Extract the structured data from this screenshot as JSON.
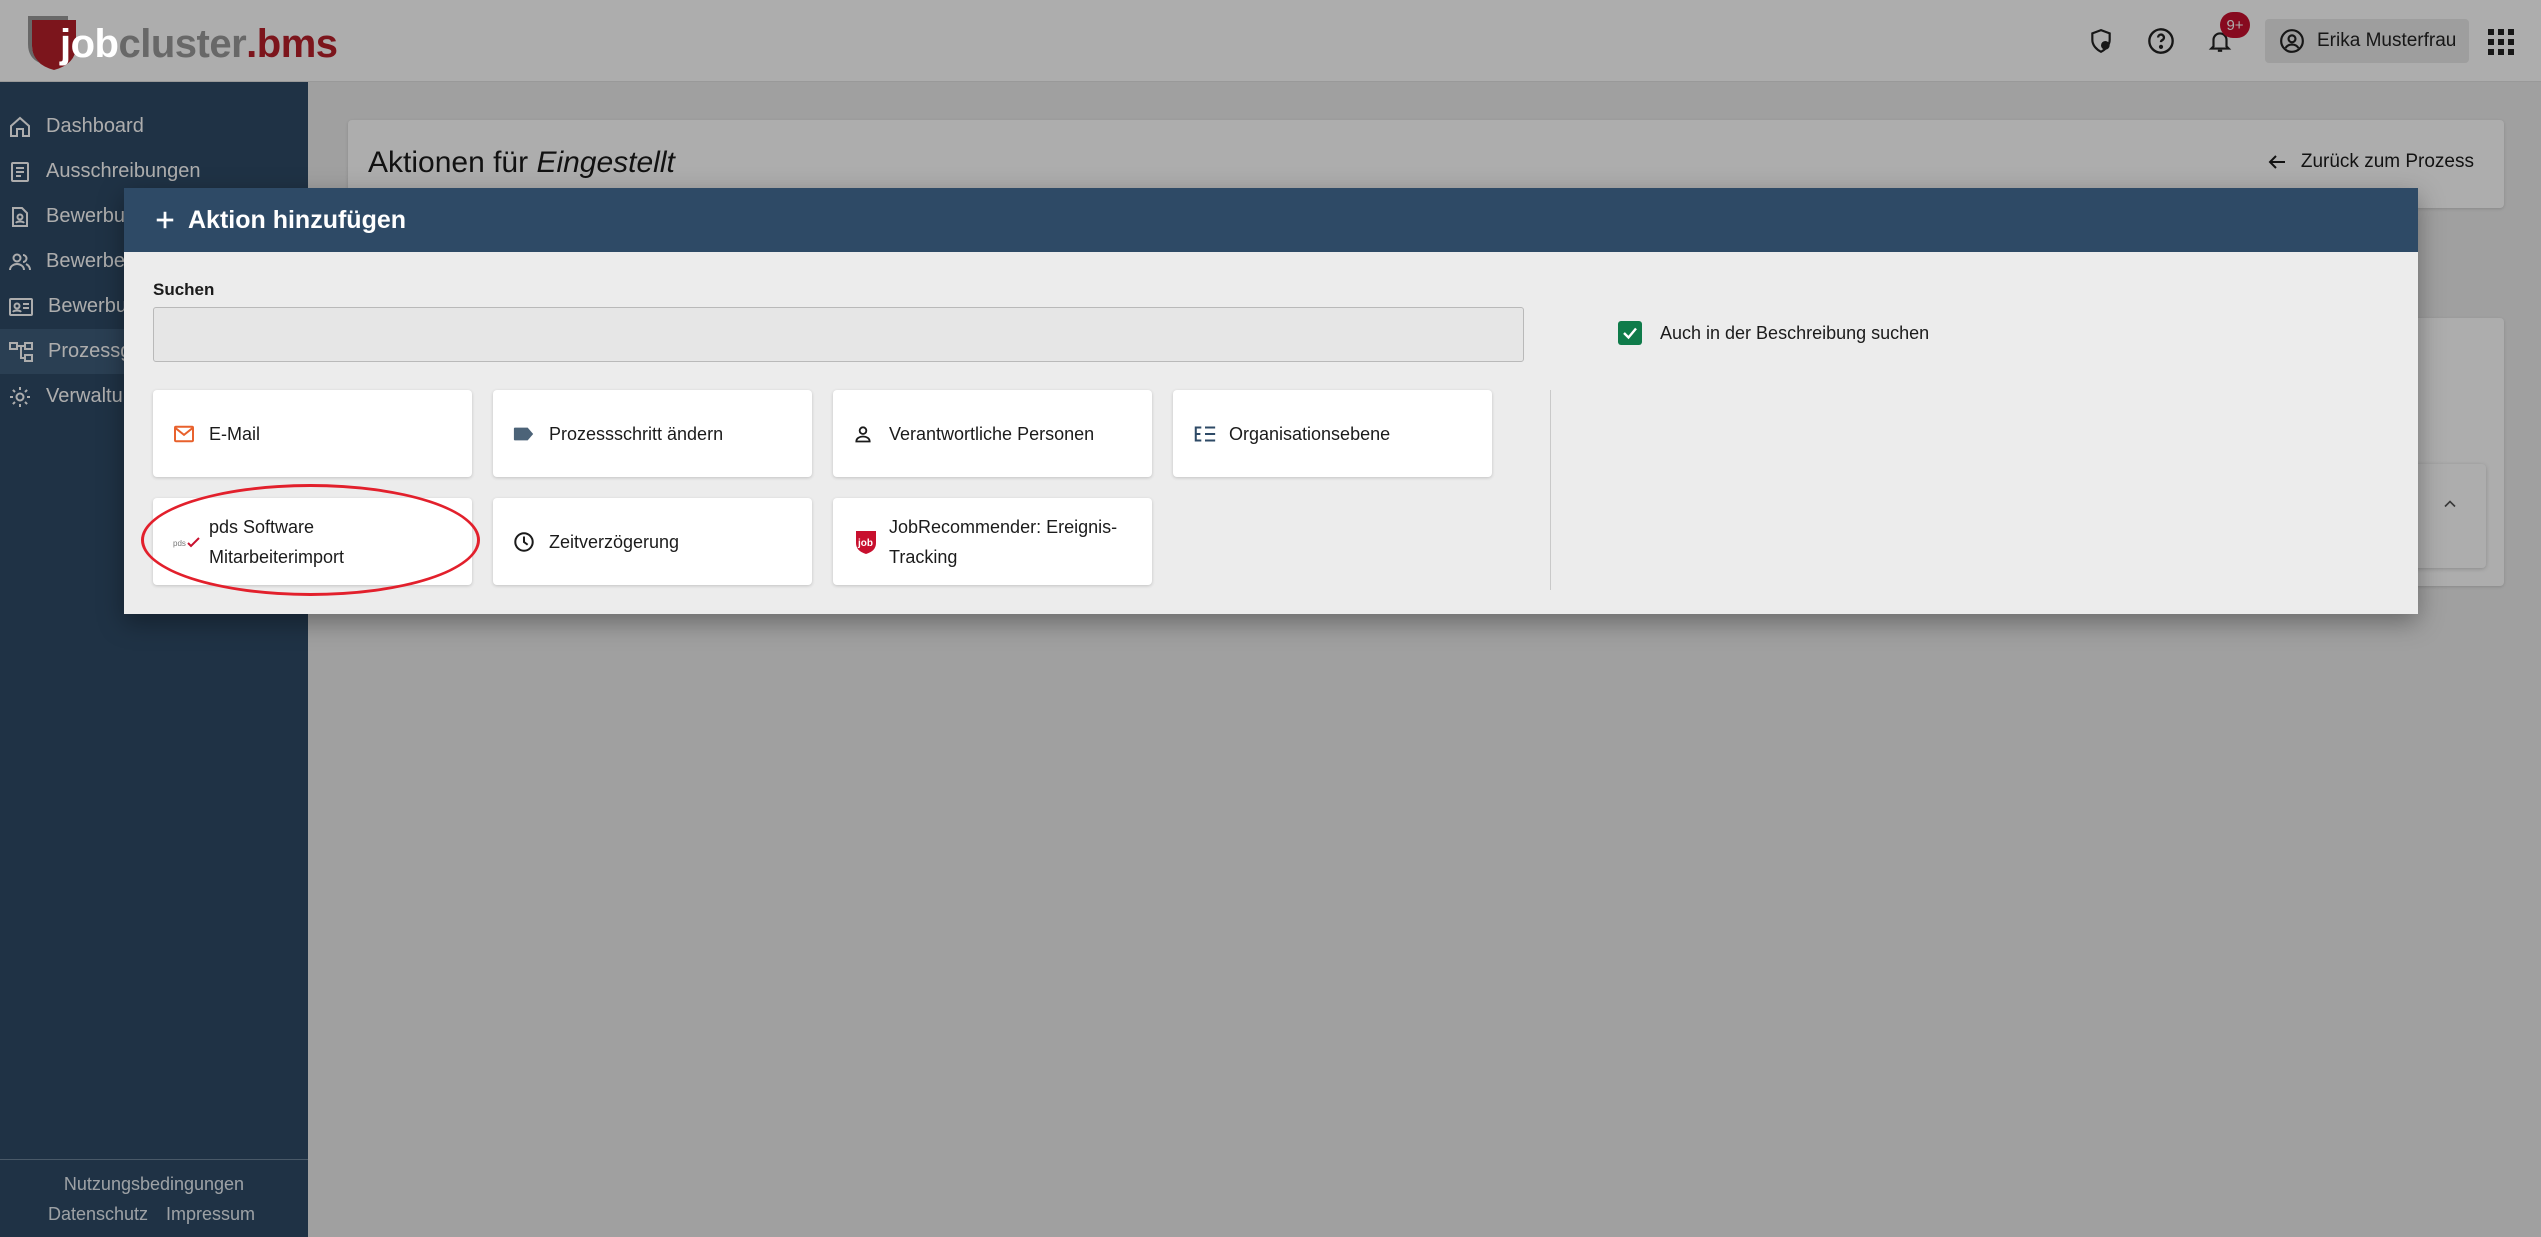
{
  "header": {
    "logo": {
      "job": "job",
      "cluster": "cluster",
      "dot": ".",
      "bms": "bms"
    },
    "icons": [
      "shield-settings-icon",
      "help-icon",
      "bell-icon"
    ],
    "notification_badge": "9+",
    "user_name": "Erika Musterfrau"
  },
  "sidebar": {
    "items": [
      {
        "label": "Dashboard",
        "icon": "home-icon"
      },
      {
        "label": "Ausschreibungen",
        "icon": "document-icon"
      },
      {
        "label": "Bewerbu",
        "icon": "file-person-icon"
      },
      {
        "label": "Bewerbe",
        "icon": "people-icon"
      },
      {
        "label": "Bewerbu",
        "icon": "id-card-icon"
      },
      {
        "label": "Prozessg",
        "icon": "workflow-icon"
      },
      {
        "label": "Verwaltu",
        "icon": "gear-icon"
      }
    ],
    "footer": {
      "terms": "Nutzungsbedingungen",
      "privacy": "Datenschutz",
      "imprint": "Impressum"
    }
  },
  "page": {
    "title_prefix": "Aktionen für",
    "title_state": "Eingestellt",
    "back_label": "Zurück zum Prozess"
  },
  "dialog": {
    "title": "Aktion hinzufügen",
    "search_label": "Suchen",
    "search_value": "",
    "checkbox_label": "Auch in der Beschreibung suchen",
    "checkbox_checked": true,
    "actions": [
      {
        "label": "E-Mail",
        "icon": "mail-icon"
      },
      {
        "label": "Prozessschritt ändern",
        "icon": "label-tag-icon"
      },
      {
        "label": "Verantwortliche Personen",
        "icon": "person-icon"
      },
      {
        "label": "Organisationsebene",
        "icon": "hierarchy-list-icon"
      },
      {
        "label": "pds Software Mitarbeiterimport",
        "icon": "pds-logo-icon"
      },
      {
        "label": "Zeitverzögerung",
        "icon": "clock-icon"
      },
      {
        "label": "JobRecommender: Ereignis-Tracking",
        "icon": "jobcluster-logo-icon"
      }
    ]
  },
  "colors": {
    "navy": "#2e4a66",
    "brand_red": "#b71f2a",
    "check_green": "#0f7b4a",
    "mail_orange": "#e8612c",
    "highlight_red": "#e2202c"
  }
}
